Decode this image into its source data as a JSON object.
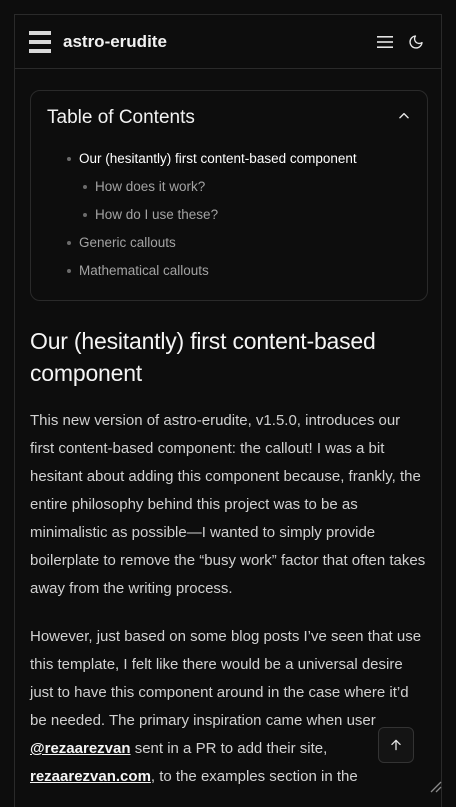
{
  "header": {
    "site_title": "astro-erudite",
    "menu_icon": "hamburger-menu-icon",
    "theme_icon": "moon-icon"
  },
  "toc": {
    "title": "Table of Contents",
    "items": [
      {
        "label": "Our (hesitantly) first content-based component",
        "level": 1,
        "active": true
      },
      {
        "label": "How does it work?",
        "level": 2
      },
      {
        "label": "How do I use these?",
        "level": 2
      },
      {
        "label": "Generic callouts",
        "level": 1
      },
      {
        "label": "Mathematical callouts",
        "level": 1
      }
    ]
  },
  "article": {
    "heading": "Our (hesitantly) first content-based component",
    "p1": "This new version of astro-erudite, v1.5.0, introduces our first content-based component: the callout! I was a bit hesitant about adding this component because, frankly, the entire philosophy behind this project was to be as minimalistic as possible—I wanted to simply provide boilerplate to remove the “busy work” factor that often takes away from the writing process.",
    "p2_a": "However, just based on some blog posts I’ve seen that use this template, I felt like there would be a universal desire just to have this component around in the case where it’d be needed. The primary inspiration came when user ",
    "p2_link1": "@rezaarezvan",
    "p2_b": " sent in a PR to add their site, ",
    "p2_link2": "rezaarezvan.com",
    "p2_c": ", to the examples section in the"
  },
  "colors": {
    "background": "#0d0d0d",
    "text": "#d1d1d1",
    "heading": "#f5f5f5",
    "muted": "#a3a3a3",
    "border": "#2a2a2a"
  }
}
